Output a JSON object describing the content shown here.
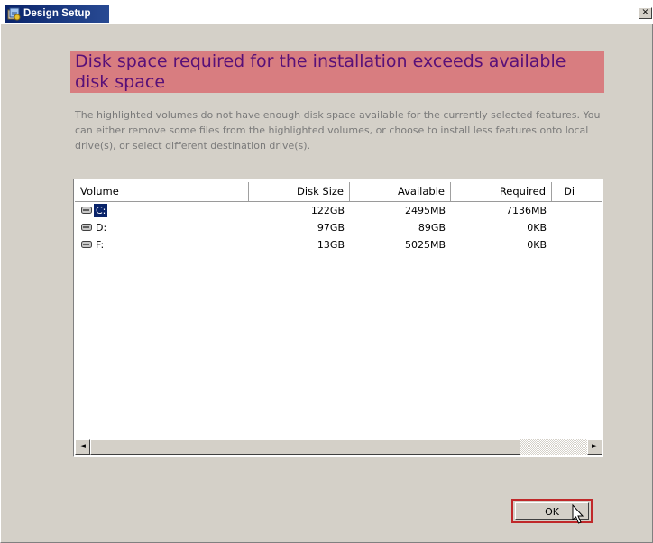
{
  "window": {
    "title": "Design Setup",
    "close_glyph": "×",
    "icon": "setup-app-icon"
  },
  "dialog": {
    "heading": "Disk space required for the installation exceeds available disk space",
    "description": "The highlighted volumes do not have enough disk space available for the currently selected features.  You can either remove some files from the highlighted volumes, or choose to install less features onto local drive(s), or select different destination drive(s)."
  },
  "table": {
    "columns": [
      "Volume",
      "Disk Size",
      "Available",
      "Required",
      "Di"
    ],
    "rows": [
      {
        "volume": "C:",
        "disk_size": "122GB",
        "available": "2495MB",
        "required": "7136MB",
        "selected": true
      },
      {
        "volume": "D:",
        "disk_size": "97GB",
        "available": "89GB",
        "required": "0KB",
        "selected": false
      },
      {
        "volume": "F:",
        "disk_size": "13GB",
        "available": "5025MB",
        "required": "0KB",
        "selected": false
      }
    ]
  },
  "scrollbar": {
    "left_arrow": "◄",
    "right_arrow": "►"
  },
  "buttons": {
    "ok_label": "OK"
  },
  "colors": {
    "title_bar": "#0a246a",
    "heading_bg": "#d87d80",
    "heading_text": "#581078",
    "selection": "#0a246a",
    "ok_highlight": "#c0282a"
  }
}
